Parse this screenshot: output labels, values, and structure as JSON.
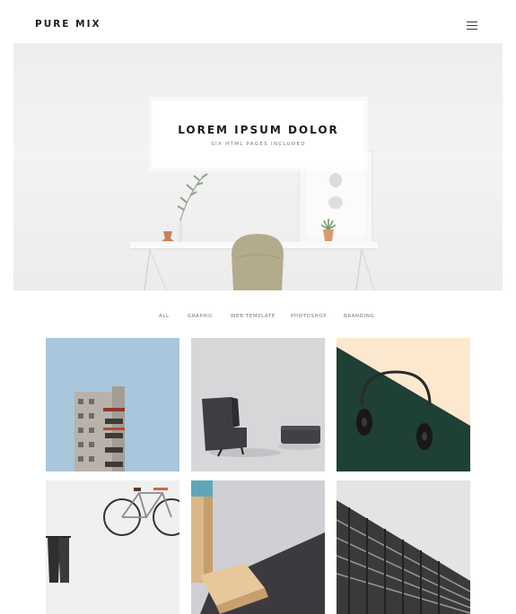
{
  "header": {
    "brand": "PURE MIX",
    "menu_icon": "hamburger-menu-icon"
  },
  "hero": {
    "title": "LOREM IPSUM DOLOR",
    "subtitle": "SIX HTML PAGES INCLUDED"
  },
  "portfolio": {
    "filters": [
      {
        "label": "ALL"
      },
      {
        "label": "GRAPHIC"
      },
      {
        "label": "WEB TEMPLATE"
      },
      {
        "label": "PHOTOSHOP"
      },
      {
        "label": "BRANDING"
      }
    ],
    "items": [
      {
        "image": "building-facade-blue-sky"
      },
      {
        "image": "dark-chair-and-ottoman"
      },
      {
        "image": "headphones-green-beige"
      },
      {
        "image": "bicycle-on-white-wall"
      },
      {
        "image": "wooden-blocks-pastel"
      },
      {
        "image": "skyscraper-looking-up"
      }
    ]
  },
  "colors": {
    "text_dark": "#222222",
    "text_muted": "#777777",
    "tile_sky": "#a9c6dc",
    "tile_green": "#1f4034",
    "tile_cream": "#fbe8cf"
  }
}
